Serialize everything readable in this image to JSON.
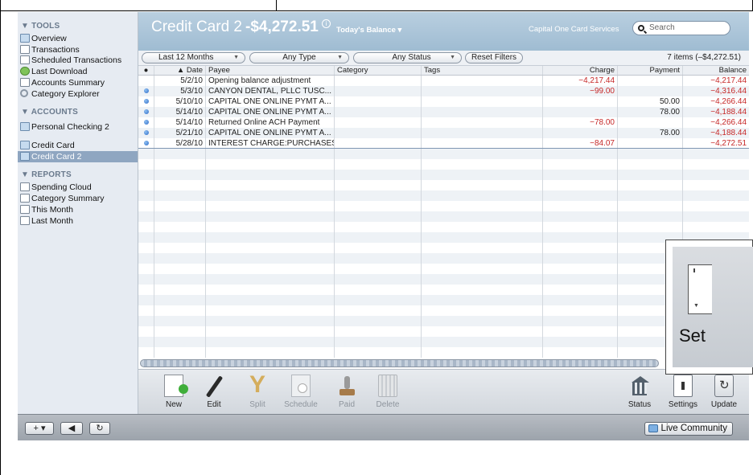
{
  "sidebar": {
    "sections": {
      "tools": "▼ TOOLS",
      "accounts": "▼ ACCOUNTS",
      "reports": "▼ REPORTS"
    },
    "tools": [
      {
        "label": "Overview"
      },
      {
        "label": "Transactions"
      },
      {
        "label": "Scheduled Transactions"
      },
      {
        "label": "Last Download"
      },
      {
        "label": "Accounts Summary"
      },
      {
        "label": "Category Explorer"
      }
    ],
    "accounts": [
      {
        "label": "Personal Checking 2"
      },
      {
        "label": "Credit Card"
      },
      {
        "label": "Credit Card 2"
      }
    ],
    "reports": [
      {
        "label": "Spending Cloud"
      },
      {
        "label": "Category Summary"
      },
      {
        "label": "This Month"
      },
      {
        "label": "Last Month"
      }
    ]
  },
  "header": {
    "account_name": "Credit Card 2",
    "balance": "-$4,272.51",
    "info_glyph": "i",
    "balance_type": "Today's Balance ▾",
    "institution": "Capital One Card Services",
    "search_placeholder": "Search"
  },
  "filters": {
    "period": "Last 12 Months",
    "type": "Any Type",
    "status": "Any Status",
    "reset": "Reset Filters",
    "items_count": "7 items (–$4,272.51)"
  },
  "table": {
    "headers": {
      "dot": "●",
      "date": "▲   Date",
      "payee": "Payee",
      "category": "Category",
      "tags": "Tags",
      "charge": "Charge",
      "payment": "Payment",
      "balance": "Balance"
    },
    "rows": [
      {
        "dot": false,
        "date": "5/2/10",
        "payee": "Opening balance adjustment",
        "category": "",
        "tags": "",
        "charge": "−4,217.44",
        "payment": "",
        "balance": "−4,217.44"
      },
      {
        "dot": true,
        "date": "5/3/10",
        "payee": "CANYON DENTAL, PLLC TUSC...",
        "category": "",
        "tags": "",
        "charge": "−99.00",
        "payment": "",
        "balance": "−4,316.44"
      },
      {
        "dot": true,
        "date": "5/10/10",
        "payee": "CAPITAL ONE ONLINE PYMT A...",
        "category": "",
        "tags": "",
        "charge": "",
        "payment": "50.00",
        "balance": "−4,266.44"
      },
      {
        "dot": true,
        "date": "5/14/10",
        "payee": "CAPITAL ONE ONLINE PYMT A...",
        "category": "",
        "tags": "",
        "charge": "",
        "payment": "78.00",
        "balance": "−4,188.44"
      },
      {
        "dot": true,
        "date": "5/14/10",
        "payee": "Returned Online ACH Payment",
        "category": "",
        "tags": "",
        "charge": "−78.00",
        "payment": "",
        "balance": "−4,266.44"
      },
      {
        "dot": true,
        "date": "5/21/10",
        "payee": "CAPITAL ONE ONLINE PYMT A...",
        "category": "",
        "tags": "",
        "charge": "",
        "payment": "78.00",
        "balance": "−4,188.44"
      },
      {
        "dot": true,
        "date": "5/28/10",
        "payee": "INTEREST CHARGE:PURCHASES",
        "category": "",
        "tags": "",
        "charge": "−84.07",
        "payment": "",
        "balance": "−4,272.51"
      }
    ]
  },
  "toolbar": {
    "new": "New",
    "edit": "Edit",
    "split": "Split",
    "schedule": "Schedule",
    "paid": "Paid",
    "delete": "Delete",
    "status": "Status",
    "settings": "Settings",
    "update": "Update"
  },
  "statusbar": {
    "add": "+ ▾",
    "back": "◀",
    "refresh": "↻",
    "live_community": "Live Community"
  },
  "callout": {
    "label": "Set"
  }
}
